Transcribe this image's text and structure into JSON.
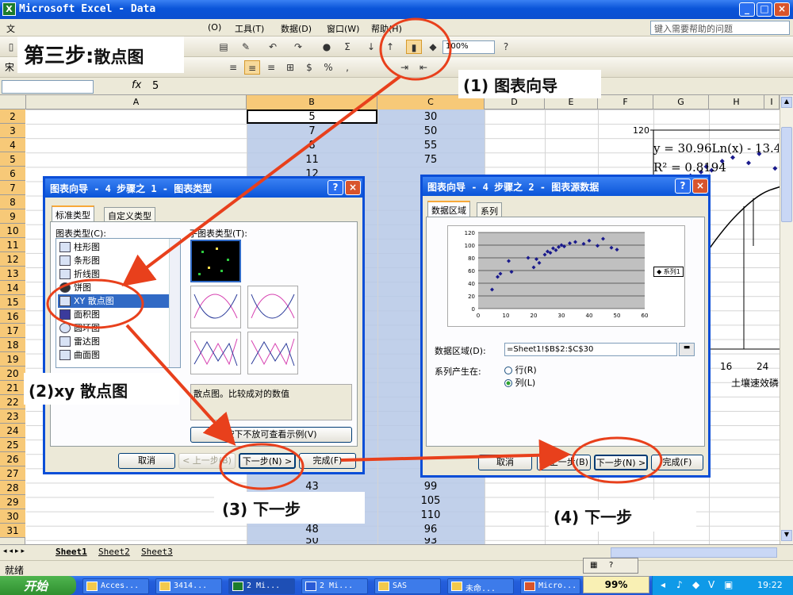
{
  "window": {
    "app_title": "Microsoft Excel - Data",
    "min_btn": "_",
    "max_btn": "□",
    "close_btn": "×"
  },
  "menu": {
    "items": [
      "文",
      "(O)",
      "工具(T)",
      "数据(D)",
      "窗口(W)",
      "帮助(H)"
    ],
    "help_placeholder": "键入需要帮助的问题"
  },
  "toolbar": {
    "zoom": "100%",
    "font_name": "宋"
  },
  "formula_bar": {
    "fx": "fx",
    "value": "5"
  },
  "columns": [
    "A",
    "B",
    "C",
    "D",
    "E",
    "F",
    "G",
    "H",
    "I"
  ],
  "rows": [
    "2",
    "3",
    "4",
    "5",
    "6",
    "7",
    "8",
    "9",
    "10",
    "11",
    "12",
    "13",
    "14",
    "15",
    "16",
    "17",
    "18",
    "19",
    "20",
    "21",
    "22",
    "23",
    "24",
    "25",
    "26",
    "27",
    "28",
    "29",
    "30",
    "31"
  ],
  "cells": {
    "B2": "5",
    "C2": "30",
    "B3": "7",
    "C3": "50",
    "B4": "8",
    "C4": "55",
    "B5": "11",
    "C5": "75",
    "B6": "12",
    "B27": "43",
    "C27": "99",
    "C28": "105",
    "C29": "110",
    "B30": "48",
    "C30": "96",
    "B31": "50",
    "C31": "93"
  },
  "bg_chart": {
    "y_tick_top": "120",
    "equation": "y = 30.96Ln(x) - 13.49",
    "r_squared": "R² = 0.8194",
    "x_tick_16": "16",
    "x_tick_24": "24",
    "x_label": "土壤速效磷"
  },
  "sheet_tabs": [
    "Sheet1",
    "Sheet2",
    "Sheet3"
  ],
  "status": "就绪",
  "taskbar": {
    "start": "开始",
    "items": [
      "Acces...",
      "3414...",
      "2 Mi...",
      "2 Mi...",
      "SAS",
      "未命...",
      "Micro..."
    ],
    "zoom_badge": "99%",
    "clock": "19:22"
  },
  "dialog1": {
    "title": "图表向导 - 4 步骤之 1 - 图表类型",
    "help_btn": "?",
    "close_btn": "×",
    "tab_standard": "标准类型",
    "tab_custom": "自定义类型",
    "chart_type_label": "图表类型(C):",
    "subtype_label": "子图表类型(T):",
    "chart_types": [
      "柱形图",
      "条形图",
      "折线图",
      "饼图",
      "XY 散点图",
      "面积图",
      "圆环图",
      "雷达图",
      "曲面图"
    ],
    "selected_index": 4,
    "description": "散点图。比较成对的数值",
    "preview_btn": "按下不放可查看示例(V)",
    "cancel_btn": "取消",
    "back_btn": "< 上一步(B)",
    "next_btn": "下一步(N) >",
    "finish_btn": "完成(F)"
  },
  "dialog2": {
    "title": "图表向导 - 4 步骤之 2 - 图表源数据",
    "help_btn": "?",
    "close_btn": "×",
    "tab_data_range": "数据区域",
    "tab_series": "系列",
    "data_range_label": "数据区域(D):",
    "data_range_value": "=Sheet1!$B$2:$C$30",
    "series_in_label": "系列产生在:",
    "row_option": "行(R)",
    "col_option": "列(L)",
    "legend": "◆ 系列1",
    "cancel_btn": "取消",
    "back_btn": "< 上一步(B)",
    "next_btn": "下一步(N) >",
    "finish_btn": "完成(F)"
  },
  "chart_data": {
    "type": "scatter",
    "legend": "系列1",
    "x_ticks": [
      "0",
      "10",
      "20",
      "30",
      "40",
      "50",
      "60"
    ],
    "y_ticks": [
      "0",
      "20",
      "40",
      "60",
      "80",
      "100",
      "120"
    ],
    "xlim": [
      0,
      60
    ],
    "ylim": [
      0,
      120
    ],
    "x": [
      5,
      7,
      8,
      11,
      12,
      18,
      20,
      21,
      22,
      24,
      25,
      26,
      27,
      28,
      29,
      30,
      31,
      33,
      35,
      38,
      40,
      43,
      45,
      48,
      50
    ],
    "y": [
      30,
      50,
      55,
      75,
      58,
      80,
      65,
      78,
      72,
      85,
      90,
      88,
      95,
      92,
      97,
      100,
      98,
      103,
      105,
      102,
      107,
      99,
      110,
      96,
      93
    ]
  },
  "annotations": {
    "step_title_a": "第三步:",
    "step_title_b": "散点图",
    "a1": "(1) 图表向导",
    "a2": "(2)xy 散点图",
    "a3": "(3) 下一步",
    "a4": "(4) 下一步"
  },
  "colors": {
    "xp_blue": "#0b4ed7",
    "selection": "#b6c8e6",
    "annotation_red": "#e8401c",
    "marker": "#1a1a8c"
  }
}
